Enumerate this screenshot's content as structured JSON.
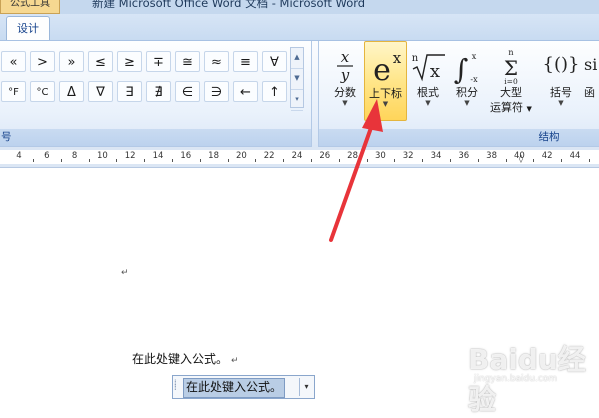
{
  "window": {
    "context_tab": "公式工具",
    "title": "新建 Microsoft Office Word 文档 - Microsoft Word"
  },
  "ribbon": {
    "active_tab": "设计",
    "symbols_group": {
      "label": "号",
      "row1": [
        "«",
        ">",
        "»",
        "≤",
        "≥",
        "∓",
        "≅",
        "≈",
        "≡",
        "∀"
      ],
      "row2": [
        "°F",
        "°C",
        "Δ",
        "∇",
        "∃",
        "∄",
        "∈",
        "∋",
        "←",
        "↑"
      ],
      "scroll": [
        "▲",
        "▼",
        "▾"
      ]
    },
    "structures_group": {
      "label": "结构",
      "buttons": [
        {
          "glyph": "x/y",
          "label": "分数"
        },
        {
          "glyph": "eˣ",
          "label": "上下标"
        },
        {
          "glyph": "ⁿ√x",
          "label": "根式"
        },
        {
          "glyph": "∫x",
          "label": "积分"
        },
        {
          "glyph": "Σ",
          "label": "大型",
          "label2": "运算符"
        },
        {
          "glyph": "{()}",
          "label": "括号"
        },
        {
          "glyph": "si",
          "label": "函"
        }
      ]
    },
    "highlight_color": "#ffd55a"
  },
  "ruler": {
    "numbers": [
      "4",
      "6",
      "8",
      "10",
      "12",
      "14",
      "16",
      "18",
      "20",
      "22",
      "24",
      "26",
      "28",
      "30",
      "32",
      "34",
      "36",
      "38",
      "40",
      "42",
      "44"
    ]
  },
  "document": {
    "paragraph_mark": "↵",
    "line_text": "在此处键入公式。",
    "equation_placeholder": "在此处键入公式。",
    "equation_dropdown": "▾"
  },
  "watermark": {
    "text": "Baidu经验",
    "sub": "jingyan.baidu.com"
  },
  "annotation": {
    "arrow_color": "#e8343a"
  }
}
